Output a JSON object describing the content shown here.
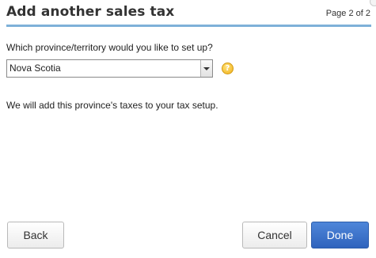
{
  "dialog": {
    "title": "Add another sales tax",
    "page_indicator": "Page 2 of 2"
  },
  "form": {
    "question": "Which province/territory would you like to set up?",
    "province_select": {
      "selected": "Nova Scotia"
    },
    "help_icon": "help-question-icon",
    "help_glyph": "?",
    "info_text": "We will add this province's taxes to your tax setup."
  },
  "buttons": {
    "back": "Back",
    "cancel": "Cancel",
    "done": "Done"
  },
  "colors": {
    "accent_rule": "#7eb1d9",
    "primary_button": "#3a70c9",
    "help_icon": "#f1b11a"
  }
}
